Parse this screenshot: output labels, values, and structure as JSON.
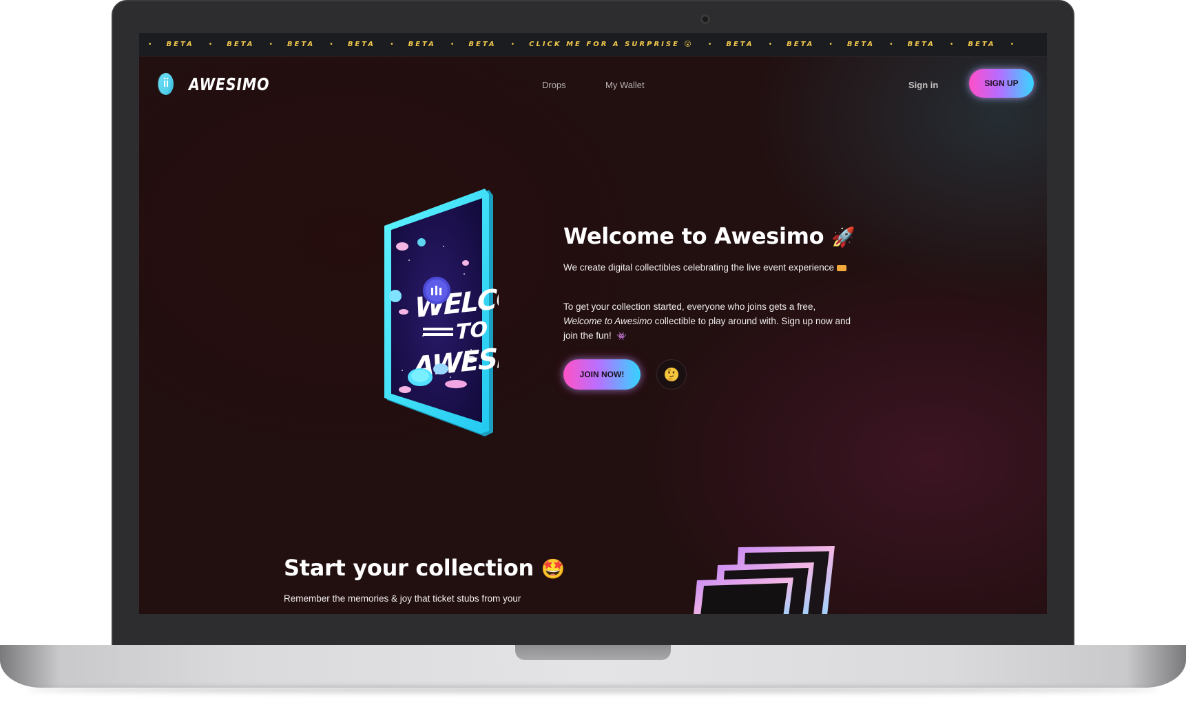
{
  "ticker": {
    "items": [
      "BETA",
      "BETA",
      "BETA",
      "BETA",
      "BETA",
      "BETA",
      "CLICK ME FOR A SURPRISE 😮",
      "BETA",
      "BETA",
      "BETA",
      "BETA",
      "BETA"
    ]
  },
  "nav": {
    "brand": "AWESIMO",
    "links": [
      "Drops",
      "My Wallet"
    ],
    "signin": "Sign in",
    "signup": "SIGN UP"
  },
  "hero": {
    "title": "Welcome to Awesimo",
    "title_emoji": "🚀",
    "p1": "We create digital collectibles celebrating the live event experience",
    "p2_before": "To get your collection started, everyone who joins gets a free,",
    "p2_italic": "Welcome to Awesimo",
    "p2_after": "collectible to play around with. Sign up now and join the fun!",
    "join_label": "JOIN NOW!",
    "card_text": [
      "WELCOME",
      "TO",
      "AWESIMO"
    ]
  },
  "section": {
    "title": "Start your collection",
    "title_emoji": "🤩",
    "text": "Remember the memories & joy that ticket stubs from your"
  },
  "icons": [
    "awesimo-logo-icon",
    "rocket-icon",
    "ticket-icon",
    "alien-icon",
    "thinking-face-icon",
    "star-eyes-icon"
  ],
  "colors": {
    "accent_pink": "#ff4fc8",
    "accent_cyan": "#36d6ff",
    "ticker_yellow": "#f2c94c",
    "background": "#220f10"
  }
}
